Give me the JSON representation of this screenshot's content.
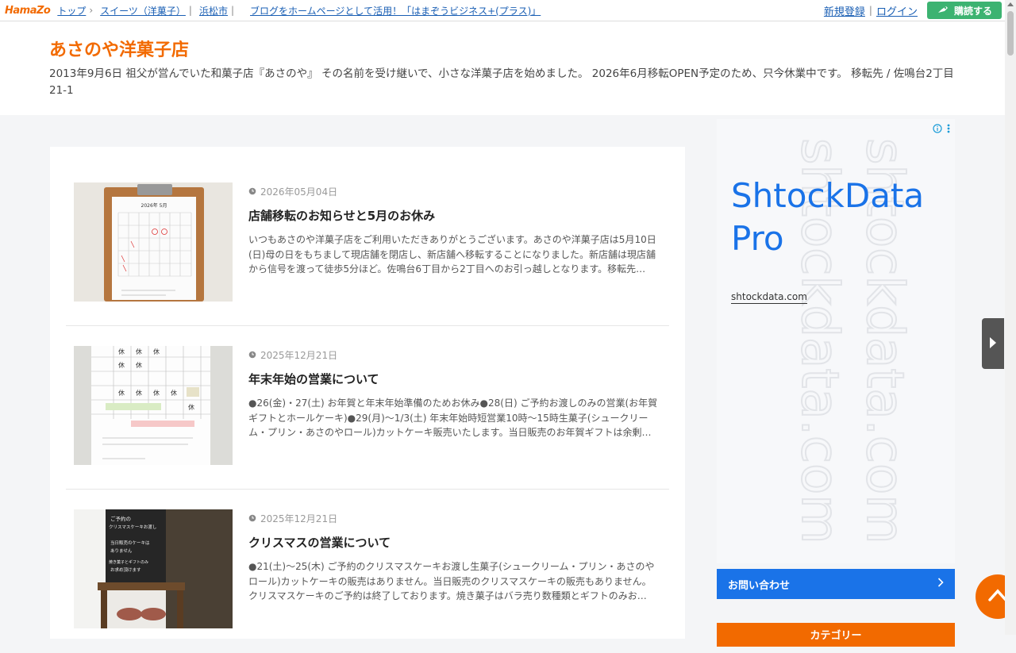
{
  "topbar": {
    "logo": "HamaZo",
    "breadcrumbs": [
      "トップ",
      "スイーツ（洋菓子）",
      "浜松市"
    ],
    "promo": "ブログをホームページとして活用！「はまぞうビジネス+(プラス)」",
    "register": "新規登録",
    "login": "ログイン",
    "subscribe": "購読する"
  },
  "header": {
    "title": "あさのや洋菓子店",
    "description": "2013年9月6日 祖父が営んでいた和菓子店『あさのや』 その名前を受け継いで、小さな洋菓子店を始めました。 2026年6月移転OPEN予定のため、只今休業中です。 移転先 / 佐鳴台2丁目21-1"
  },
  "posts": [
    {
      "date": "2026年05月04日",
      "title": "店舗移転のお知らせと5月のお休み",
      "excerpt": "いつもあさのや洋菓子店をご利用いただきありがとうございます。あさのや洋菓子店は5月10日(日)母の日をもちまして現店舗を閉店し、新店舗へ移転することになりました。新店舗は現店舗から信号を渡って徒歩5分ほど。佐鳴台6丁目から2丁目へのお引っ越しとなります。移転先…"
    },
    {
      "date": "2025年12月21日",
      "title": "年末年始の営業について",
      "excerpt": "●26(金)・27(土) お年賀と年末年始準備のためお休み●28(日) ご予約お渡しのみの営業(お年賀ギフトとホールケーキ)●29(月)〜1/3(土) 年末年始時短営業10時〜15時生菓子(シュークリーム・プリン・あさのやロール)カットケーキ販売いたします。当日販売のお年賀ギフトは余剰…"
    },
    {
      "date": "2025年12月21日",
      "title": "クリスマスの営業について",
      "excerpt": "●21(土)〜25(木) ご予約のクリスマスケーキお渡し生菓子(シュークリーム・プリン・あさのやロール)カットケーキの販売はありません。当日販売のクリスマスケーキの販売もありません。クリスマスケーキのご予約は終了しております。焼き菓子はバラ売り数種類とギフトのみお…"
    }
  ],
  "ad": {
    "title": "ShtockData Pro",
    "url": "shtockdata.com",
    "watermark": "shtockdata.com"
  },
  "sidebar": {
    "contact": "お問い合わせ",
    "category": "カテゴリー"
  },
  "thumbs": {
    "calendar_title": "2026年 5月",
    "dec_cells": [
      "休",
      "休",
      "休",
      "休",
      "休",
      "休",
      "休",
      "休",
      "休",
      "休",
      "休"
    ],
    "board_lines": [
      "ご予約の",
      "クリスマスケーキお渡し",
      "当日販売のケーキは",
      "ありません",
      "焼き菓子とギフトのみ",
      "お求め頂けます"
    ]
  },
  "colors": {
    "accent": "#f26a00",
    "link": "#1a5fb4",
    "ad_blue": "#1a73e8",
    "subscribe": "#3cb371"
  }
}
